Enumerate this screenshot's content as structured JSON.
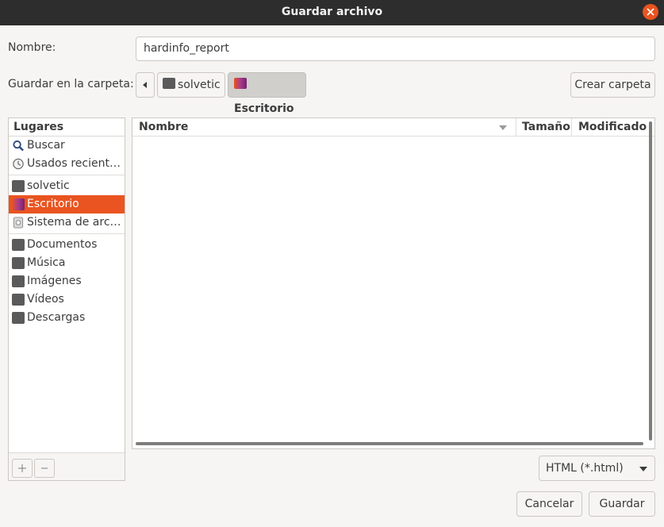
{
  "window": {
    "title": "Guardar archivo"
  },
  "name_row": {
    "label": "Nombre:",
    "value": "hardinfo_report"
  },
  "folder_row": {
    "label": "Guardar en la carpeta:",
    "path": [
      {
        "label": "solvetic"
      },
      {
        "label": "Escritorio"
      }
    ],
    "create_folder_label": "Crear carpeta"
  },
  "places": {
    "header": "Lugares",
    "items": [
      {
        "label": "Buscar",
        "icon": "search-icon"
      },
      {
        "label": "Usados recient…",
        "icon": "recent-icon"
      },
      {
        "label": "solvetic",
        "icon": "home-folder-icon"
      },
      {
        "label": "Escritorio",
        "icon": "desktop-folder-icon",
        "selected": true
      },
      {
        "label": "Sistema de arc…",
        "icon": "drive-icon"
      },
      {
        "label": "Documentos",
        "icon": "folder-icon"
      },
      {
        "label": "Música",
        "icon": "folder-icon"
      },
      {
        "label": "Imágenes",
        "icon": "folder-icon"
      },
      {
        "label": "Vídeos",
        "icon": "folder-icon"
      },
      {
        "label": "Descargas",
        "icon": "folder-icon"
      }
    ]
  },
  "files": {
    "columns": [
      "Nombre",
      "Tamaño",
      "Modificado"
    ]
  },
  "filter": {
    "selected": "HTML (*.html)"
  },
  "actions": {
    "cancel_label": "Cancelar",
    "save_label": "Guardar"
  },
  "colors": {
    "accent": "#e95420",
    "titlebar": "#2d2d2d"
  }
}
